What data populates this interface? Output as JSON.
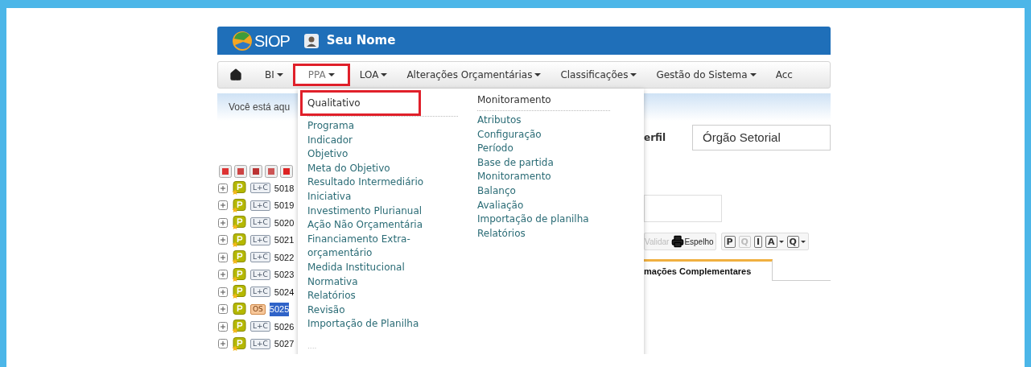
{
  "header": {
    "logo_text": "SIOP",
    "user": "Seu Nome"
  },
  "nav": [
    {
      "label": "BI",
      "caret": true,
      "selected": false,
      "highlighted": false
    },
    {
      "label": "PPA",
      "caret": true,
      "selected": true,
      "highlighted": true
    },
    {
      "label": "LOA",
      "caret": true,
      "selected": false,
      "highlighted": false
    },
    {
      "label": "Alterações Orçamentárias",
      "caret": true,
      "selected": false,
      "highlighted": false
    },
    {
      "label": "Classificações",
      "caret": true,
      "selected": false,
      "highlighted": false
    },
    {
      "label": "Gestão do Sistema",
      "caret": true,
      "selected": false,
      "highlighted": false
    },
    {
      "label": "Acc",
      "caret": false,
      "selected": false,
      "highlighted": false
    }
  ],
  "breadcrumb": "Você está aqu",
  "tree": [
    {
      "code": "5018",
      "badge": "L+C",
      "kind": "lc",
      "selected": false
    },
    {
      "code": "5019",
      "badge": "L+C",
      "kind": "lc",
      "selected": false
    },
    {
      "code": "5020",
      "badge": "L+C",
      "kind": "lc",
      "selected": false
    },
    {
      "code": "5021",
      "badge": "L+C",
      "kind": "lc",
      "selected": false
    },
    {
      "code": "5022",
      "badge": "L+C",
      "kind": "lc",
      "selected": false
    },
    {
      "code": "5023",
      "badge": "L+C",
      "kind": "lc",
      "selected": false
    },
    {
      "code": "5024",
      "badge": "L+C",
      "kind": "lc",
      "selected": false
    },
    {
      "code": "5025",
      "badge": "OS",
      "kind": "os",
      "selected": true
    },
    {
      "code": "5026",
      "badge": "L+C",
      "kind": "lc",
      "selected": false
    },
    {
      "code": "5027",
      "badge": "L+C",
      "kind": "lc",
      "selected": false
    }
  ],
  "profile": {
    "label": "erfil",
    "value": "Órgão Setorial"
  },
  "toolbar": {
    "validate": {
      "label": "Validar",
      "disabled": true
    },
    "print": {
      "label": "Espelho"
    },
    "icon_buttons": [
      {
        "letter": "P",
        "disabled": false,
        "dropdown": false
      },
      {
        "letter": "Q",
        "disabled": true,
        "dropdown": false
      },
      {
        "letter": "I",
        "disabled": false,
        "dropdown": false
      },
      {
        "letter": "A",
        "disabled": false,
        "dropdown": true
      },
      {
        "letter": "Q",
        "disabled": false,
        "dropdown": true
      }
    ]
  },
  "tab": {
    "label": "mações Complementares",
    "selected": true
  },
  "menu": {
    "columns": [
      {
        "header": "Qualitativo",
        "highlighted": true,
        "items": [
          "Programa",
          "Indicador",
          "Objetivo",
          "Meta do Objetivo",
          "Resultado Intermediário",
          "Iniciativa",
          "Investimento Plurianual",
          "Ação Não Orçamentária",
          "Financiamento Extra-orçamentário",
          "Medida Institucional",
          "Normativa",
          "Relatórios",
          "Revisão",
          "Importação de Planilha"
        ],
        "more": "...."
      },
      {
        "header": "Monitoramento",
        "highlighted": false,
        "items": [
          "Atributos",
          "Configuração",
          "Período",
          "Base de partida",
          "Monitoramento",
          "Balanço",
          "Avaliação",
          "Importação de planilha",
          "Relatórios"
        ]
      }
    ]
  }
}
